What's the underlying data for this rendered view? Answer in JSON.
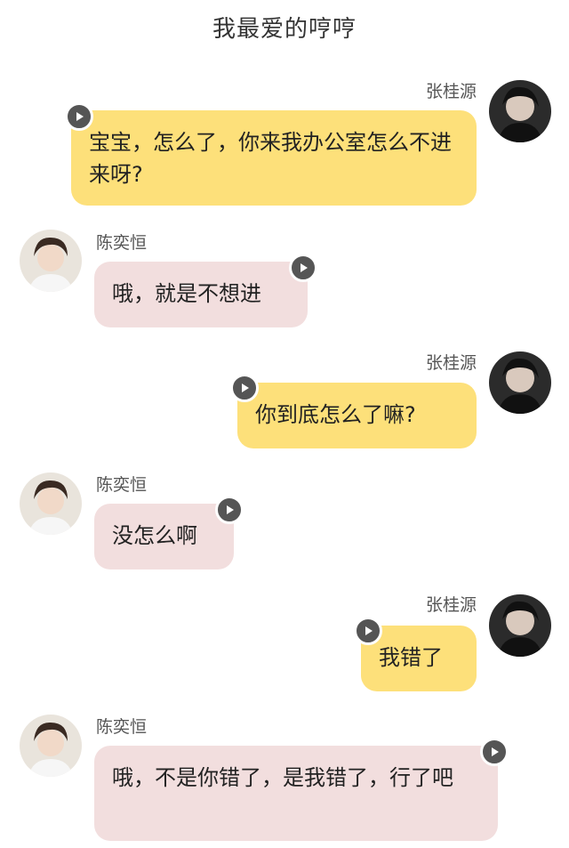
{
  "title": "我最爱的哼哼",
  "messages": [
    {
      "speaker": "张桂源",
      "side": "right",
      "text": "宝宝，怎么了，你来我办公室怎么不进来呀?",
      "icon": "play-icon"
    },
    {
      "speaker": "陈奕恒",
      "side": "left",
      "text": "哦，就是不想进",
      "icon": "play-icon"
    },
    {
      "speaker": "张桂源",
      "side": "right",
      "text": "你到底怎么了嘛?",
      "icon": "play-icon"
    },
    {
      "speaker": "陈奕恒",
      "side": "left",
      "text": "没怎么啊",
      "icon": "play-icon"
    },
    {
      "speaker": "张桂源",
      "side": "right",
      "text": "我错了",
      "icon": "play-icon"
    },
    {
      "speaker": "陈奕恒",
      "side": "left",
      "text": "哦，不是你错了，是我错了，行了吧",
      "icon": "play-icon"
    }
  ],
  "colors": {
    "right_bubble": "#fde07a",
    "left_bubble": "#f2dede",
    "play_button": "#555555"
  }
}
